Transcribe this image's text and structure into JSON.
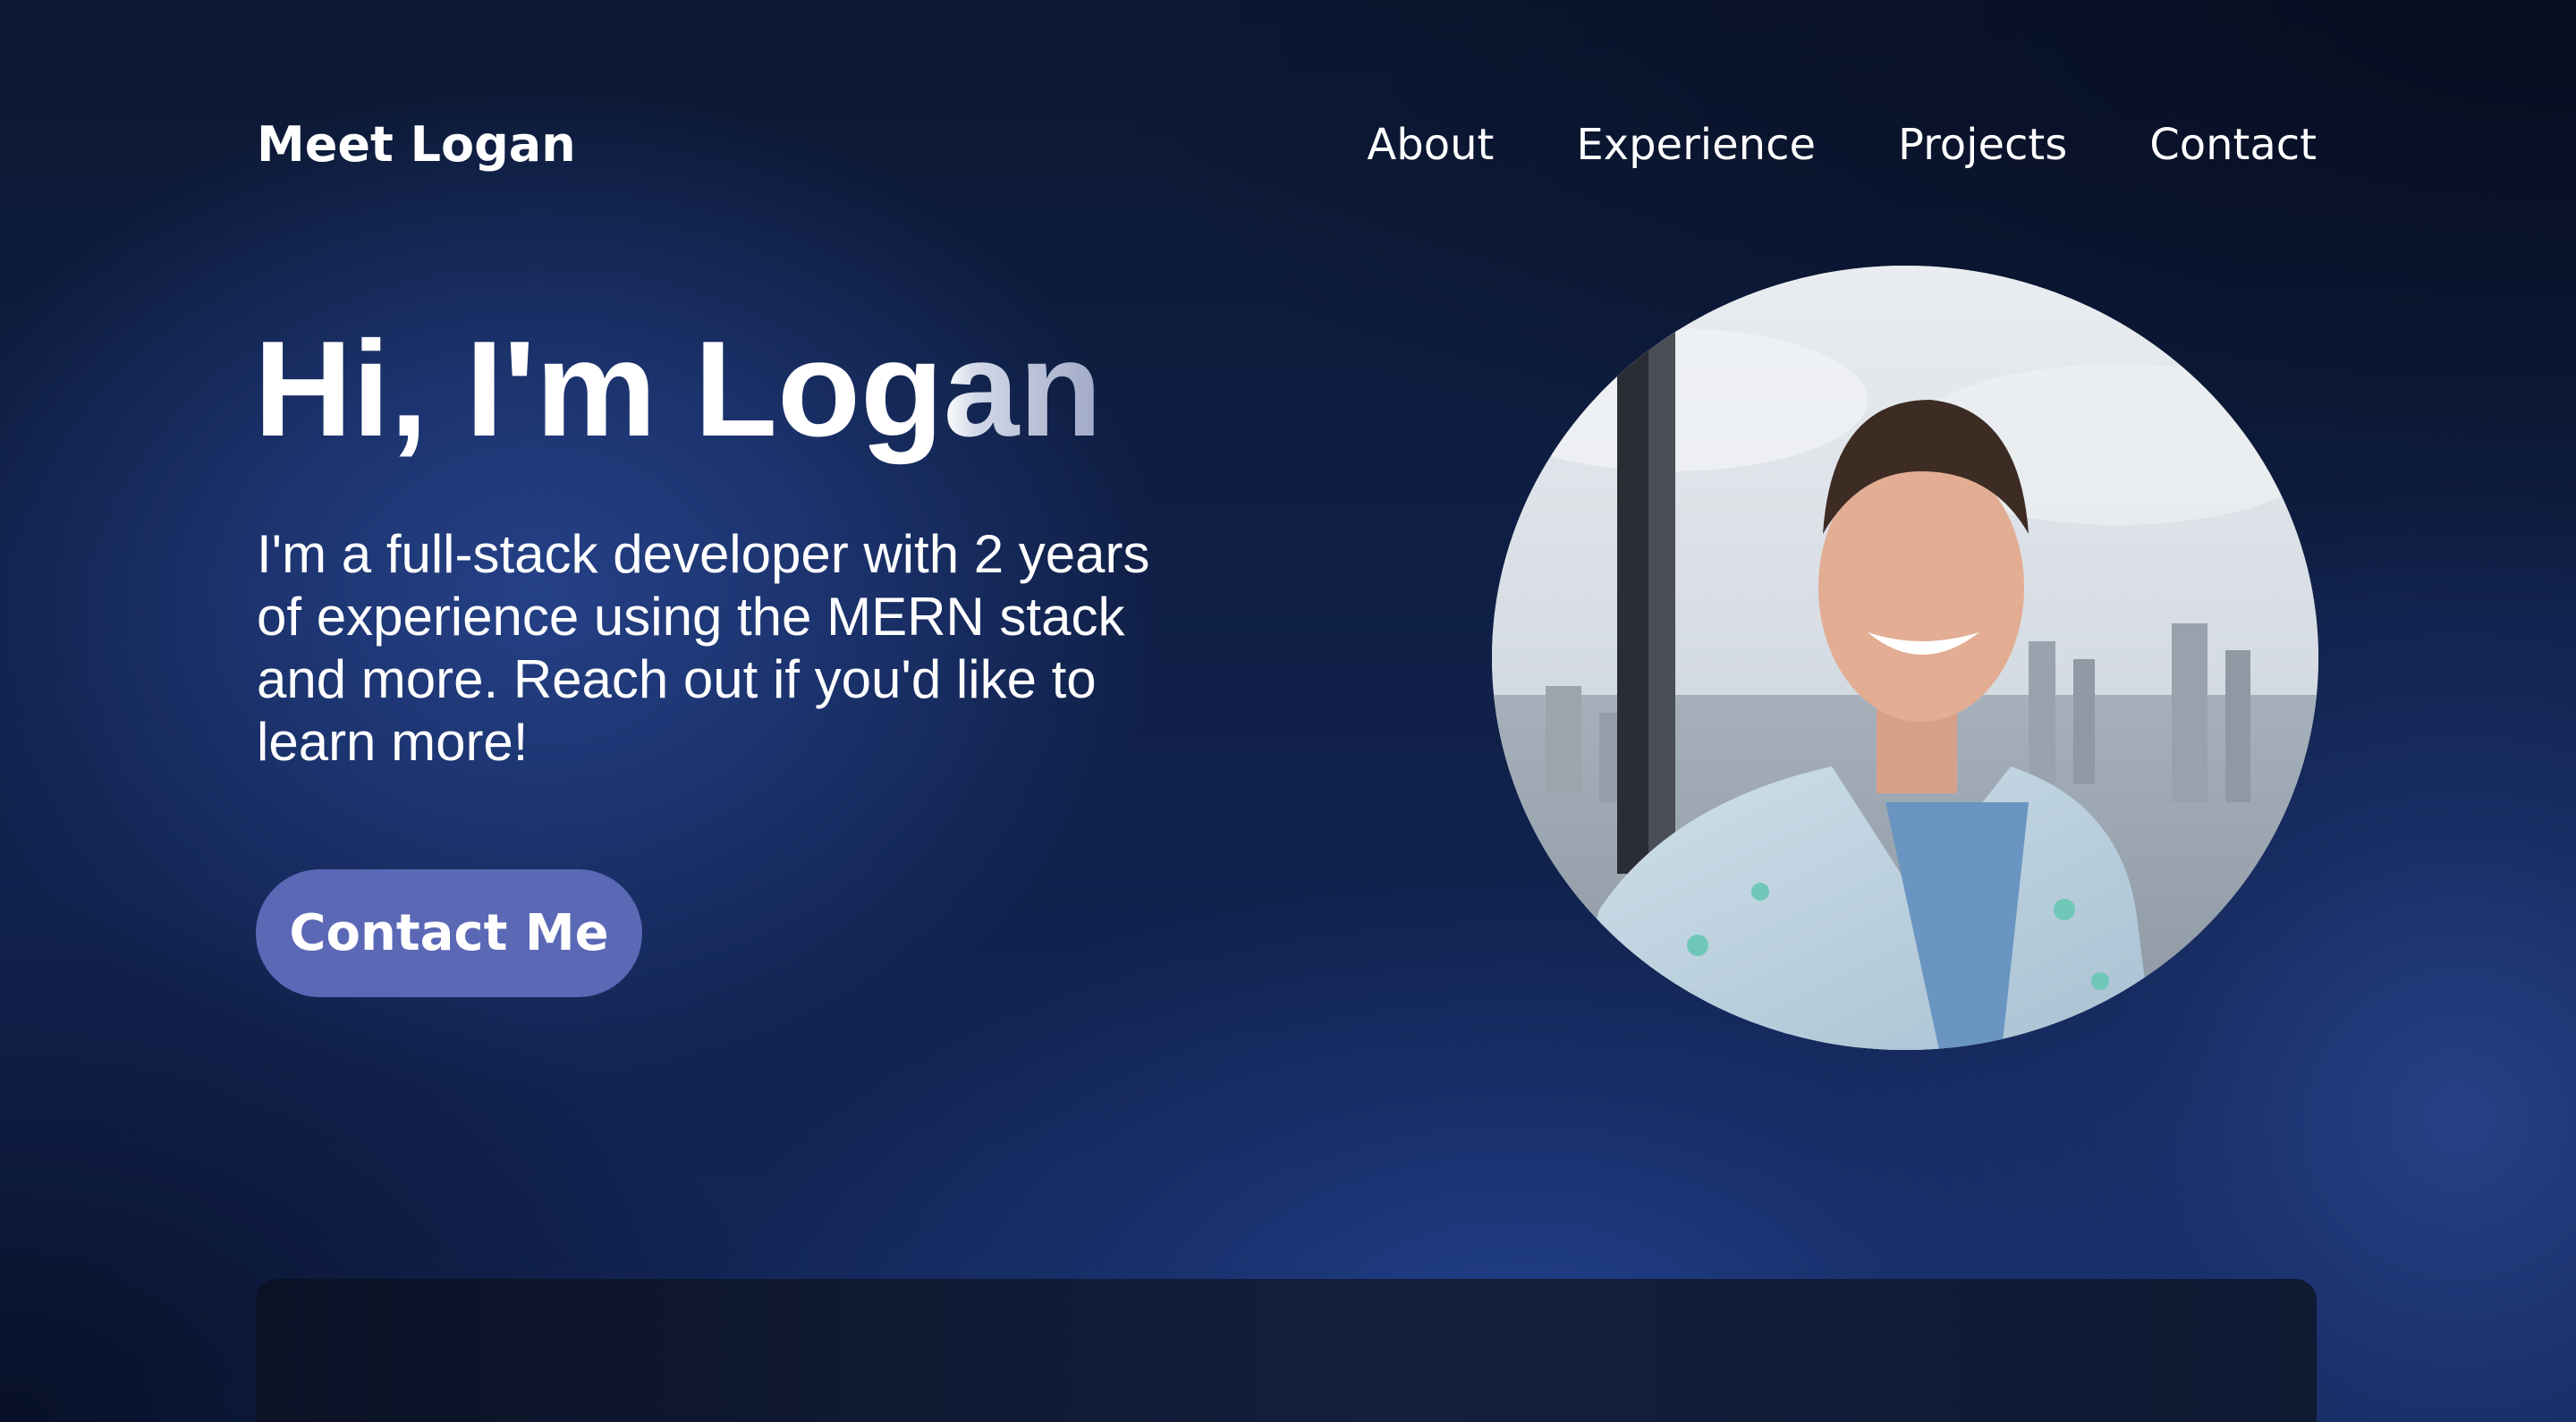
{
  "header": {
    "brand": "Meet Logan",
    "nav": [
      "About",
      "Experience",
      "Projects",
      "Contact"
    ]
  },
  "hero": {
    "title_main": "Hi, I'm Log",
    "title_fading": "an",
    "description": "I'm a full-stack developer with 2 years of experience using the MERN stack and more. Reach out if you'd like to learn more!",
    "cta_label": "Contact Me"
  },
  "colors": {
    "background": "#13275a",
    "cta": "#5b68b6",
    "text": "#ffffff",
    "panel": "#0f1a33"
  },
  "icons": {
    "profile_photo": "portrait-photo"
  }
}
